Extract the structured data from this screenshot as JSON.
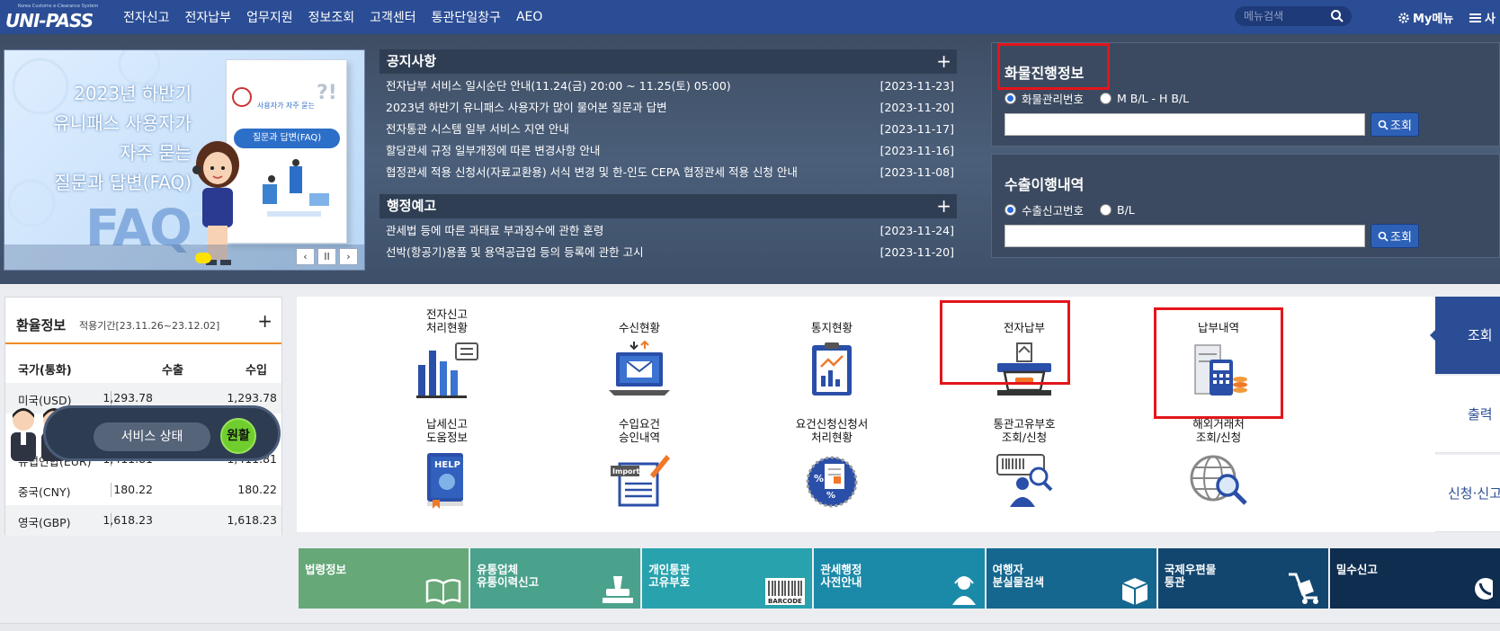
{
  "header": {
    "logo_small": "Korea Customs e-Clearance System",
    "logo_text": "UNI-PASS",
    "nav": [
      "전자신고",
      "전자납부",
      "업무지원",
      "정보조회",
      "고객센터",
      "통관단일창구",
      "AEO"
    ],
    "search_placeholder": "메뉴검색",
    "mymenu": "My메뉴",
    "sitemap": "사"
  },
  "banner": {
    "title_lines": [
      "2023년 하반기",
      "유니패스 사용자가",
      "자주 묻는",
      "질문과 답변(FAQ)"
    ],
    "book_caption": "사용자가 자주 묻는",
    "book_title": "질문과 답변(FAQ)",
    "faq_text": "FAQ",
    "prev": "‹",
    "pause": "II",
    "next": "›"
  },
  "notices": {
    "title": "공지사항",
    "plus": "+",
    "items": [
      {
        "title": "전자납부 서비스 일시순단 안내(11.24(금) 20:00 ~ 11.25(토) 05:00)",
        "date": "[2023-11-23]"
      },
      {
        "title": "2023년 하반기 유니패스 사용자가 많이 물어본 질문과 답변",
        "date": "[2023-11-20]"
      },
      {
        "title": "전자통관 시스템 일부 서비스 지연 안내",
        "date": "[2023-11-17]"
      },
      {
        "title": "할당관세 규정 일부개정에 따른 변경사항 안내",
        "date": "[2023-11-16]"
      },
      {
        "title": "협정관세 적용 신청서(자료교환용) 서식 변경 및 한-인도 CEPA 협정관세 적용 신청 안내",
        "date": "[2023-11-08]"
      }
    ]
  },
  "admin": {
    "title": "행정예고",
    "plus": "+",
    "items": [
      {
        "title": "관세법 등에 따른 과태료 부과징수에 관한 훈령",
        "date": "[2023-11-24]"
      },
      {
        "title": "선박(항공기)용품 및 용역공급업 등의 등록에 관한 고시",
        "date": "[2023-11-20]"
      }
    ]
  },
  "cargo": {
    "title": "화물진행정보",
    "options": [
      "화물관리번호",
      "M B/L - H B/L"
    ],
    "button": "조회"
  },
  "export": {
    "title": "수출이행내역",
    "options": [
      "수출신고번호",
      "B/L"
    ],
    "button": "조회"
  },
  "rates": {
    "title": "환율정보",
    "period": "적용기간[23.11.26~23.12.02]",
    "plus": "+",
    "col_country": "국가(통화)",
    "col_export": "수출",
    "col_import": "수입",
    "rows": [
      {
        "country": "미국(USD)",
        "export": "1,293.78",
        "import": "1,293.78"
      },
      {
        "country": "유럽연합(EUR)",
        "export": "1,411.81",
        "import": "1,411.81"
      },
      {
        "country": "중국(CNY)",
        "export": "180.22",
        "import": "180.22"
      },
      {
        "country": "영국(GBP)",
        "export": "1,618.23",
        "import": "1,618.23"
      }
    ]
  },
  "status": {
    "label": "서비스 상태",
    "value": "원활"
  },
  "services": [
    "전자신고\n처리현황",
    "수신현황",
    "통지현황",
    "전자납부",
    "납부내역",
    "납세신고\n도움정보",
    "수입요건\n승인내역",
    "요건신청신청서\n처리현황",
    "통관고유부호\n조회/신청",
    "해외거래처\n조회/신청"
  ],
  "icon_text": {
    "help": "HELP",
    "import": "Import",
    "barcode": "BARCODE"
  },
  "side_tabs": [
    "조회",
    "출력",
    "신청·신고"
  ],
  "quick_links": [
    {
      "label": "법령정보",
      "color": "#66a878"
    },
    {
      "label": "유통업체\n유통이력신고",
      "color": "#4aa28c"
    },
    {
      "label": "개인통관\n고유부호",
      "color": "#28a2ad"
    },
    {
      "label": "관세행정\n사전안내",
      "color": "#1b8aa8"
    },
    {
      "label": "여행자\n분실물검색",
      "color": "#15678f"
    },
    {
      "label": "국제우편물\n통관",
      "color": "#12466f"
    },
    {
      "label": "밀수신고",
      "color": "#0f2d4f"
    }
  ]
}
